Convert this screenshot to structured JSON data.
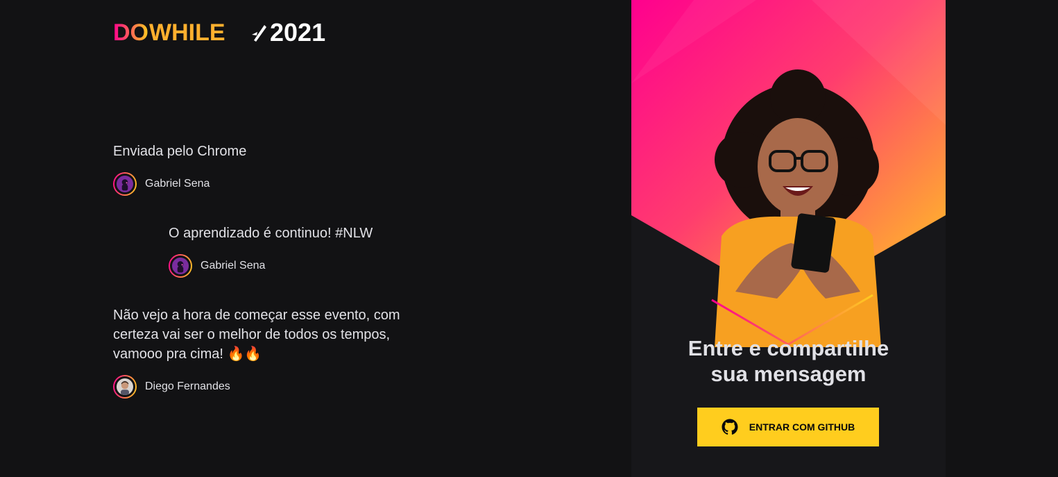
{
  "logo": {
    "text_do": "DO",
    "text_while": "WHILE",
    "text_year": "2021",
    "colors": {
      "gradient_start": "#ff008e",
      "gradient_end": "#ffcd1e",
      "year": "#ffffff"
    }
  },
  "messages": [
    {
      "content": "Enviada pelo Chrome",
      "user": {
        "name": "Gabriel Sena",
        "avatar_icon": "avatar-purple-character"
      }
    },
    {
      "content": "O aprendizado é continuo! #NLW",
      "user": {
        "name": "Gabriel Sena",
        "avatar_icon": "avatar-purple-character"
      }
    },
    {
      "content": "Não vejo a hora de começar esse evento, com certeza vai ser o melhor de todos os tempos, vamooo pra cima! 🔥🔥",
      "user": {
        "name": "Diego Fernandes",
        "avatar_icon": "avatar-person-photo"
      }
    }
  ],
  "login": {
    "title_line1": "Entre e compartilhe",
    "title_line2": "sua mensagem",
    "button_label": "ENTRAR COM GITHUB",
    "button_icon": "github-icon",
    "hero_image": "woman-with-phone-illustration"
  },
  "theme": {
    "background": "#121214",
    "panel": "#17171a",
    "accent_pink": "#ff008e",
    "accent_yellow": "#ffcd1e",
    "text": "#e1e1e6"
  }
}
